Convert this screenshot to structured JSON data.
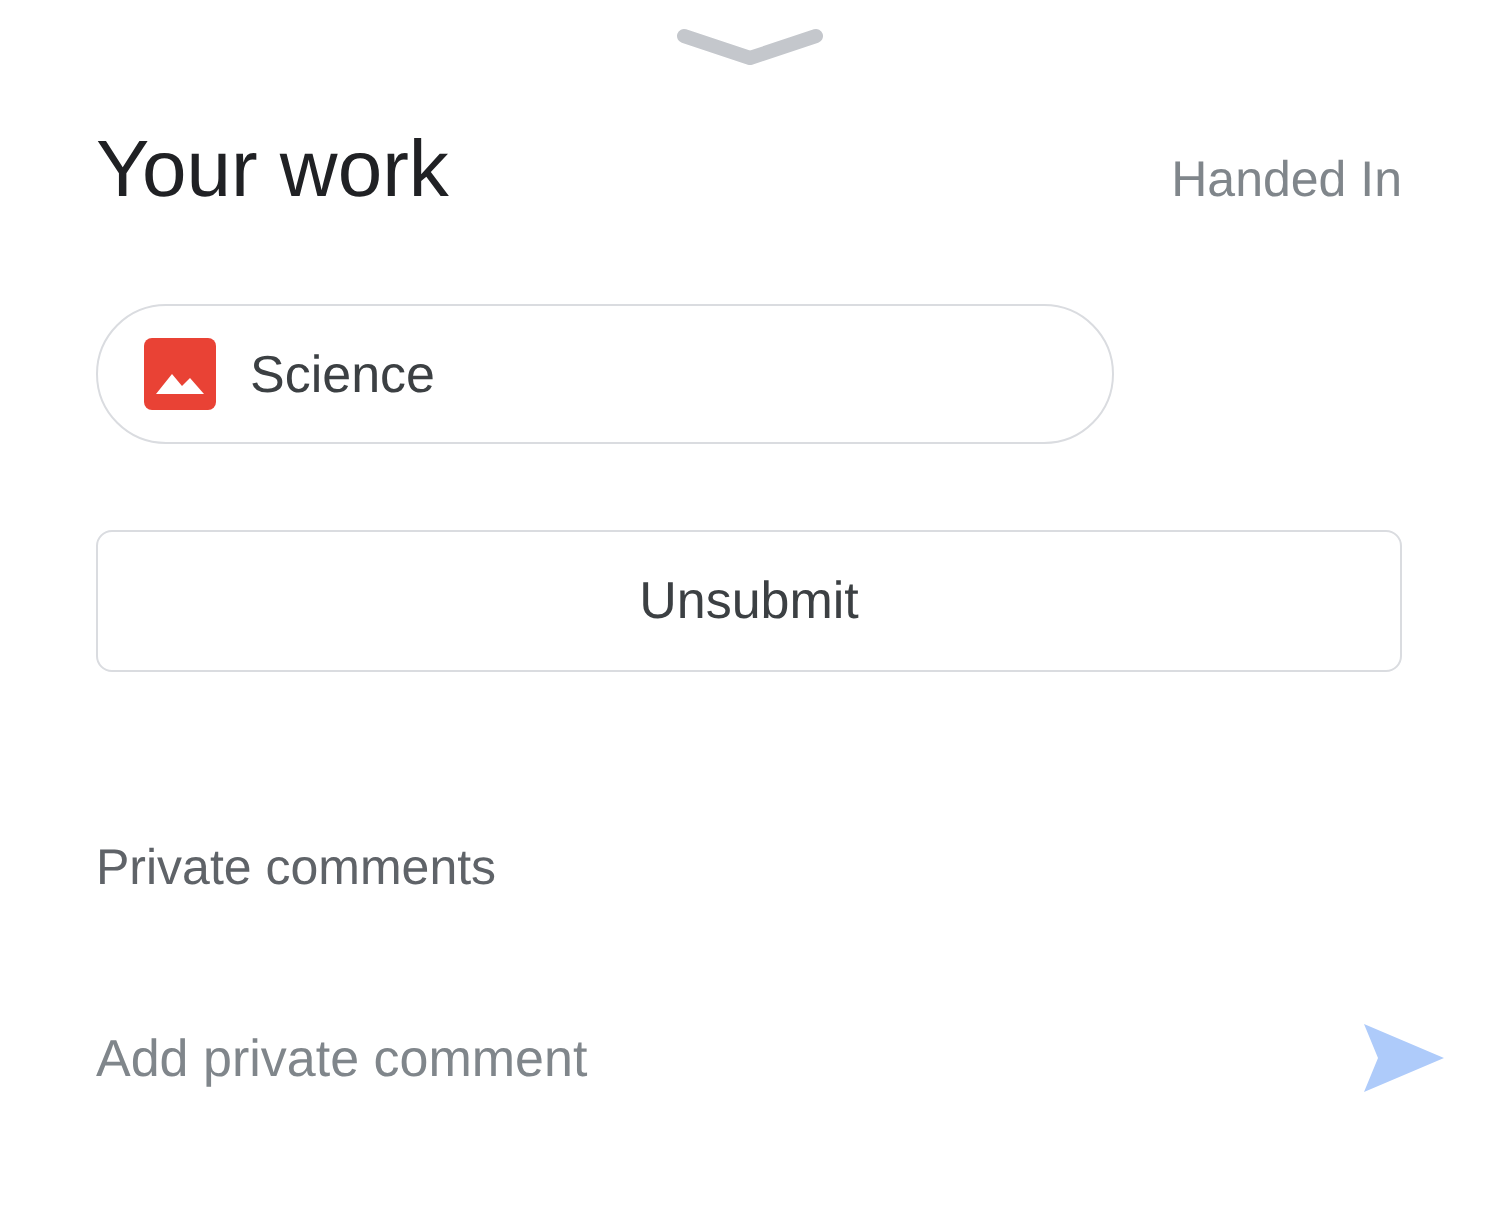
{
  "header": {
    "title": "Your work",
    "status": "Handed In"
  },
  "attachments": [
    {
      "title": "Science"
    }
  ],
  "action_button": {
    "label": "Unsubmit"
  },
  "private_comments": {
    "heading": "Private comments",
    "placeholder": "Add private comment"
  }
}
